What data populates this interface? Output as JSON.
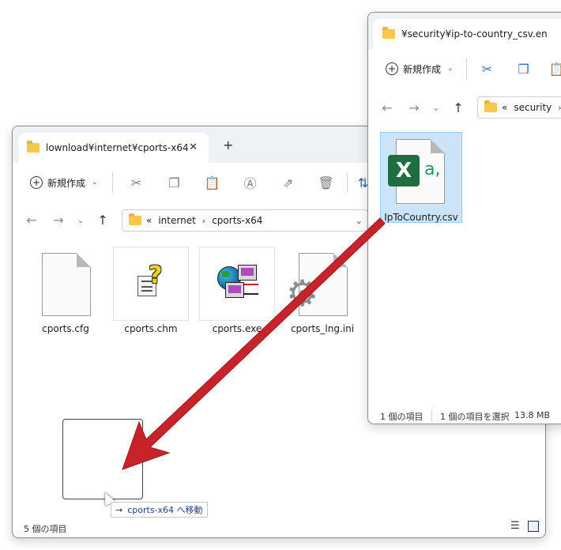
{
  "back_window": {
    "tab_title": "lownload¥internet¥cports-x64",
    "tab_close": "✕",
    "new_tab": "+",
    "toolbar": {
      "new_label": "新規作成"
    },
    "address": {
      "prefix": "«",
      "crumbs": [
        "internet",
        "cports-x64"
      ]
    },
    "files": [
      {
        "name": "cports.cfg"
      },
      {
        "name": "cports.chm"
      },
      {
        "name": "cports.exe"
      },
      {
        "name": "cports_lng.ini"
      }
    ],
    "status": {
      "count": "5 個の項目"
    }
  },
  "front_window": {
    "tab_title": "¥security¥ip-to-country_csv.en",
    "toolbar": {
      "new_label": "新規作成"
    },
    "address": {
      "prefix": "«",
      "crumbs": [
        "security"
      ]
    },
    "files": [
      {
        "name": "IpToCountry.csv"
      }
    ],
    "status": {
      "count": "1 個の項目",
      "selected": "1 個の項目を選択",
      "size": "13.8 MB"
    }
  },
  "drag": {
    "tooltip": "cports-x64 へ移動",
    "arrow_glyph": "→"
  },
  "excel_icon": {
    "letter": "X",
    "suffix": "a,"
  },
  "colors": {
    "arrow_red": "#c8222a",
    "selection": "#cce4f7",
    "excel_green": "#1d6f42",
    "folder": "#f7c84a"
  }
}
